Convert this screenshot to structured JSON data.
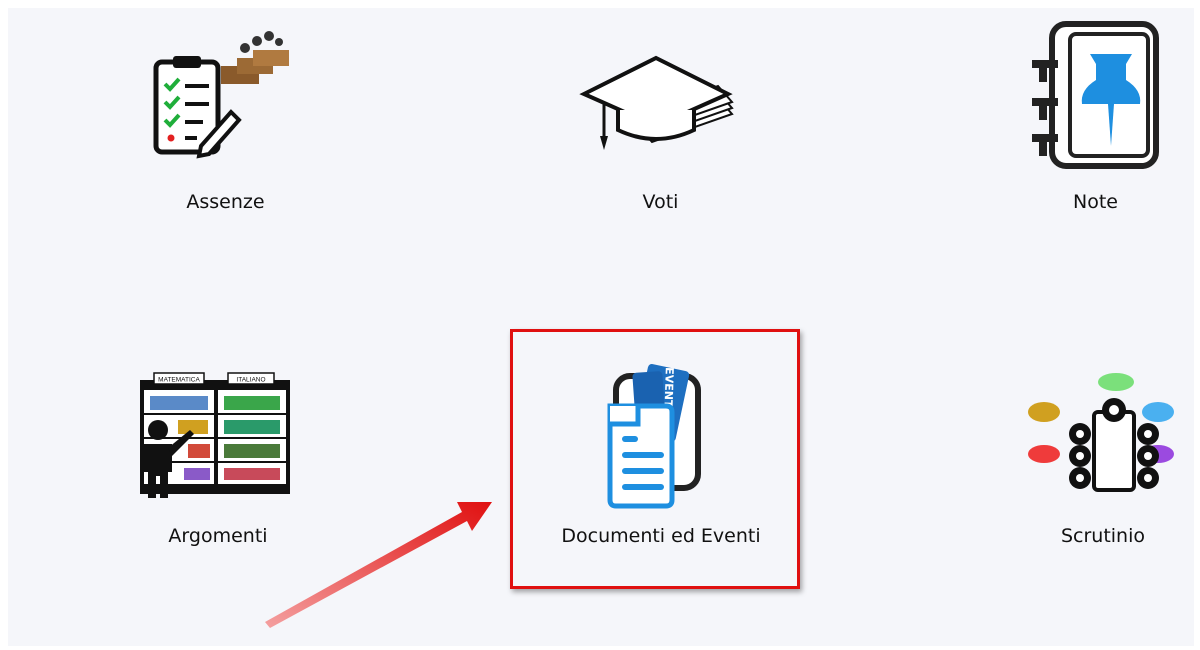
{
  "tiles": {
    "assenze": {
      "label": "Assenze",
      "icon": "attendance-clipboard-icon"
    },
    "voti": {
      "label": "Voti",
      "icon": "graduation-cap-icon"
    },
    "note": {
      "label": "Note",
      "icon": "notebook-pin-icon"
    },
    "argomenti": {
      "label": "Argomenti",
      "icon": "bookshelf-teacher-icon"
    },
    "documenti": {
      "label": "Documenti ed Eventi",
      "icon": "documents-events-icon"
    },
    "scrutinio": {
      "label": "Scrutinio",
      "icon": "meeting-table-icon"
    }
  },
  "shelf_labels": {
    "left": "MATEMATICA",
    "right": "ITALIANO"
  },
  "event_ticket_text": "EVENT",
  "colors": {
    "highlight": "#e01010",
    "arrow": "#e01010",
    "accent_blue": "#1e8fe0",
    "background": "#f5f6fa"
  }
}
